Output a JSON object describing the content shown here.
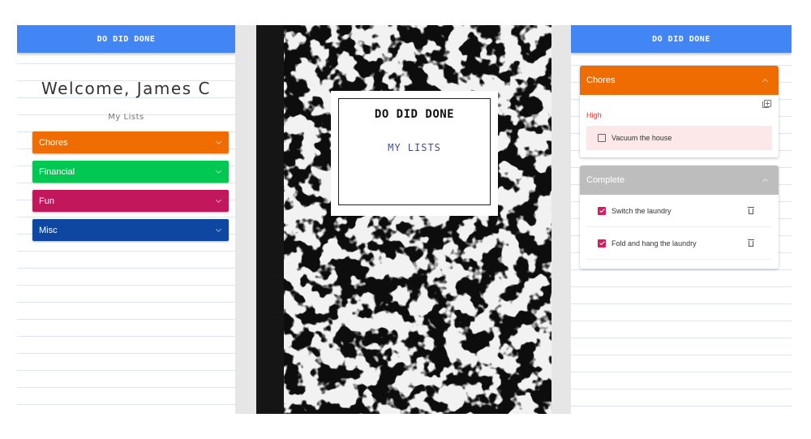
{
  "app": {
    "title": "DO DID DONE"
  },
  "left_screen": {
    "welcome": "Welcome, James C",
    "subtitle": "My Lists",
    "lists": [
      {
        "label": "Chores",
        "color": "#ef6c00"
      },
      {
        "label": "Financial",
        "color": "#00c853"
      },
      {
        "label": "Fun",
        "color": "#c2185b"
      },
      {
        "label": "Misc",
        "color": "#0d47a1"
      }
    ]
  },
  "cover": {
    "title": "DO DID DONE",
    "subtitle": "MY LISTS"
  },
  "right_screen": {
    "chores_panel": {
      "title": "Chores",
      "color": "#ef6c00",
      "priority_label": "High",
      "tasks": [
        {
          "text": "Vacuum the house",
          "checked": false
        }
      ]
    },
    "complete_panel": {
      "title": "Complete",
      "color": "#bdbdbd",
      "tasks": [
        {
          "text": "Switch the laundry",
          "checked": true
        },
        {
          "text": "Fold and hang the laundry",
          "checked": true
        }
      ]
    }
  },
  "icons": [
    "chevron-down-icon",
    "chevron-up-icon",
    "add-to-list-icon",
    "trash-icon",
    "checkbox-icon"
  ]
}
